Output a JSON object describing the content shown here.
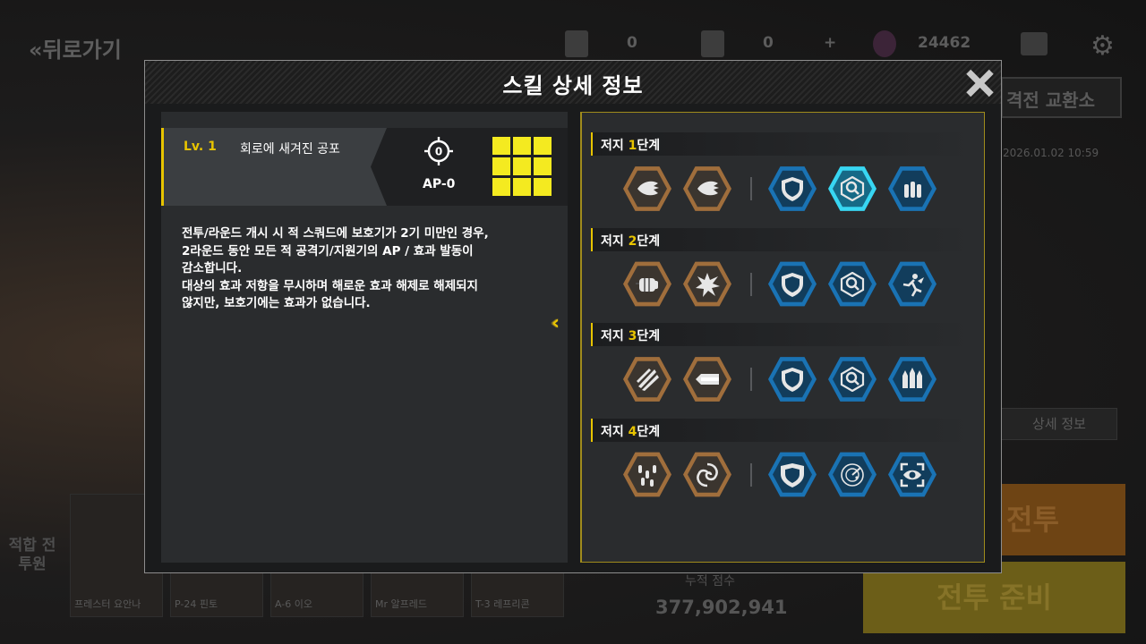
{
  "background": {
    "back_label": "뒤로가기",
    "resources": [
      "0",
      "0",
      "24462"
    ],
    "exchange_label": "격전 교환소",
    "date": "2026.01.02 10:59",
    "detail_label": "상세 정보",
    "battle_label": "전투",
    "ready_label": "전투 준비",
    "fit_label": "적합 전투원",
    "cards": [
      "프레스터 요안나",
      "P-24 핀토",
      "A-6 이오",
      "Mr 알프레드",
      "T-3 레프리콘"
    ],
    "score_label": "누적 점수",
    "score": "377,902,941"
  },
  "modal": {
    "title": "스킬 상세 정보",
    "close_icon": "close-icon"
  },
  "skill": {
    "level": "Lv. 1",
    "name": "회로에 새겨진 공포",
    "ap": "AP-0",
    "target_value": "0",
    "description": [
      "전투/라운드 개시 시 적 스쿼드에 보호기가 2기 미만인 경우,",
      "2라운드 동안 모든 적 공격기/지원기의 AP / 효과 발동이",
      "감소합니다.",
      "대상의 효과 저항을 무시하며 해로운 효과 해제로 해제되지",
      "않지만, 보호기에는 효과가 없습니다."
    ]
  },
  "stages": [
    {
      "prefix": "저지 ",
      "num": "1",
      "suffix": "단계",
      "icons": [
        {
          "name": "feather-burst-icon",
          "type": "brown"
        },
        {
          "name": "feather-burst-icon",
          "type": "brown"
        },
        {
          "name": "shield-icon",
          "type": "blue"
        },
        {
          "name": "magnifier-badge-icon",
          "type": "cyan"
        },
        {
          "name": "ammo-icon",
          "type": "blue"
        }
      ]
    },
    {
      "prefix": "저지 ",
      "num": "2",
      "suffix": "단계",
      "icons": [
        {
          "name": "fist-icon",
          "type": "brown"
        },
        {
          "name": "explosion-icon",
          "type": "brown"
        },
        {
          "name": "shield-icon",
          "type": "blue"
        },
        {
          "name": "magnifier-badge-icon",
          "type": "blue"
        },
        {
          "name": "winged-runner-icon",
          "type": "blue"
        }
      ]
    },
    {
      "prefix": "저지 ",
      "num": "3",
      "suffix": "단계",
      "icons": [
        {
          "name": "claw-slash-icon",
          "type": "brown"
        },
        {
          "name": "beam-icon",
          "type": "brown"
        },
        {
          "name": "shield-icon",
          "type": "blue"
        },
        {
          "name": "magnifier-badge-icon",
          "type": "blue"
        },
        {
          "name": "missile-launch-icon",
          "type": "blue"
        }
      ]
    },
    {
      "prefix": "저지 ",
      "num": "4",
      "suffix": "단계",
      "icons": [
        {
          "name": "bullet-rain-icon",
          "type": "brown"
        },
        {
          "name": "vortex-icon",
          "type": "brown"
        },
        {
          "name": "crest-shield-icon",
          "type": "blue"
        },
        {
          "name": "radar-icon",
          "type": "blue"
        },
        {
          "name": "target-eye-icon",
          "type": "blue"
        }
      ]
    }
  ],
  "colors": {
    "accent": "#e8c400",
    "hex_brown": "#a06e3c",
    "hex_blue": "#1a73b4",
    "hex_selected": "#38d6f2"
  }
}
